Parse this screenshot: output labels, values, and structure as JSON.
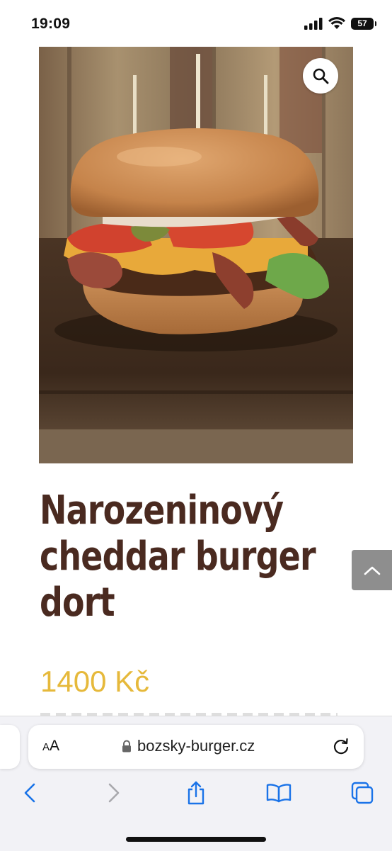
{
  "status_bar": {
    "time": "19:09",
    "battery": "57"
  },
  "product": {
    "image_alt": "cheddar burger",
    "title_lines": [
      "Narozeninový",
      "cheddar burger",
      "dort"
    ],
    "price": "1400 Kč"
  },
  "browser": {
    "aa_label_small": "A",
    "aa_label_large": "A",
    "url": "bozsky-burger.cz"
  },
  "colors": {
    "title": "#4a2a20",
    "price": "#e6b93b",
    "ios_blue": "#1a73e8"
  },
  "icons": [
    "signal-icon",
    "wifi-icon",
    "battery-icon",
    "search-icon",
    "chevron-up-icon",
    "lock-icon",
    "reload-icon",
    "back-icon",
    "forward-icon",
    "share-icon",
    "bookmarks-icon",
    "tabs-icon"
  ]
}
